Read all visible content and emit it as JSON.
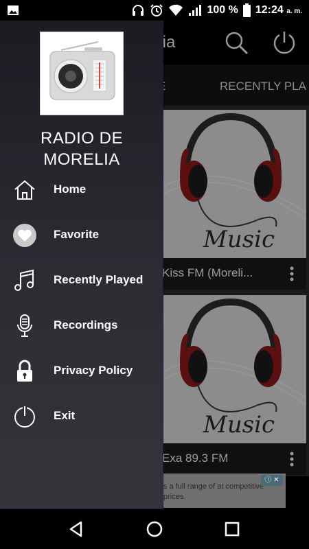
{
  "status_bar": {
    "icons": [
      "image-icon",
      "headphones-icon",
      "alarm-icon",
      "wifi-icon",
      "signal-icon",
      "battery-icon"
    ],
    "battery": "100 %",
    "time": "12:24",
    "ampm": "a. m."
  },
  "app": {
    "title": "relia",
    "tabs": [
      "E",
      "RECENTLY PLA"
    ],
    "cards": [
      {
        "title": "Kiss FM (Moreli..."
      },
      {
        "title": "Exa 89.3 FM"
      }
    ],
    "ad_text": "s a full range of at competitive prices."
  },
  "drawer": {
    "app_name": "RADIO DE MORELIA",
    "items": [
      {
        "label": "Home",
        "icon": "home-icon"
      },
      {
        "label": "Favorite",
        "icon": "heart-icon"
      },
      {
        "label": "Recently Played",
        "icon": "music-note-icon"
      },
      {
        "label": "Recordings",
        "icon": "microphone-icon"
      },
      {
        "label": "Privacy Policy",
        "icon": "lock-icon"
      },
      {
        "label": "Exit",
        "icon": "power-icon"
      }
    ]
  },
  "nav_bar": {
    "buttons": [
      "back-icon",
      "home-circle-icon",
      "recents-icon"
    ]
  },
  "colors": {
    "drawer_top": "#1b1b22",
    "drawer_bottom": "#34343a",
    "drawer_border": "#1a1550",
    "text": "#ffffff"
  }
}
